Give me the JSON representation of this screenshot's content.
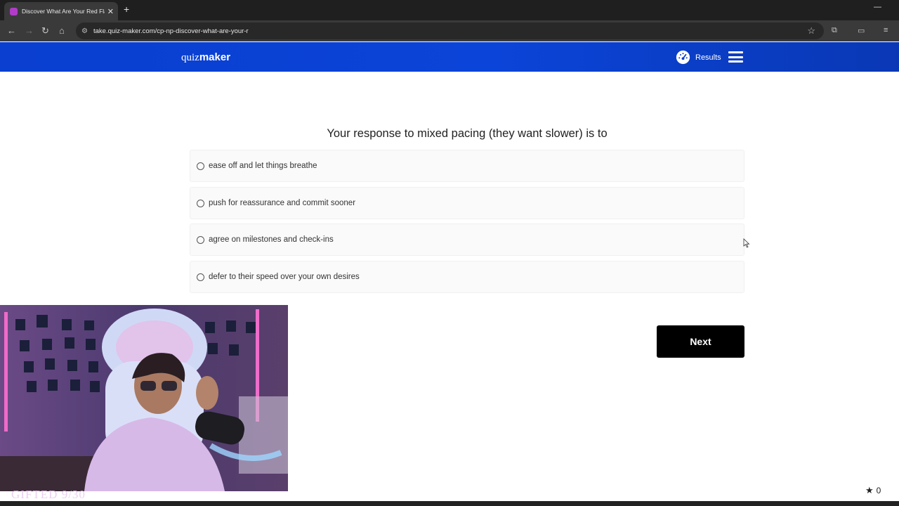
{
  "browser": {
    "tab_title": "Discover What Are Your Red Fla",
    "tab_close": "✕",
    "new_tab": "+",
    "url": "take.quiz-maker.com/cp-np-discover-what-are-your-r",
    "minimize": "—",
    "maximize": "☐",
    "window_close": "✕"
  },
  "header": {
    "logo_light": "quiz",
    "logo_bold": "maker",
    "results_label": "Results"
  },
  "quiz": {
    "question": "Your response to mixed pacing (they want slower) is to",
    "answers": [
      "ease off and let things breathe",
      "push for reassurance and commit sooner",
      "agree on milestones and check-ins",
      "defer to their speed over your own desires"
    ],
    "next_label": "Next"
  },
  "stream_overlay": {
    "gift_text": "GIFTED 9/30",
    "star_count": "0"
  },
  "colors": {
    "header_blue": "#0a3fd0",
    "next_button": "#000000"
  }
}
